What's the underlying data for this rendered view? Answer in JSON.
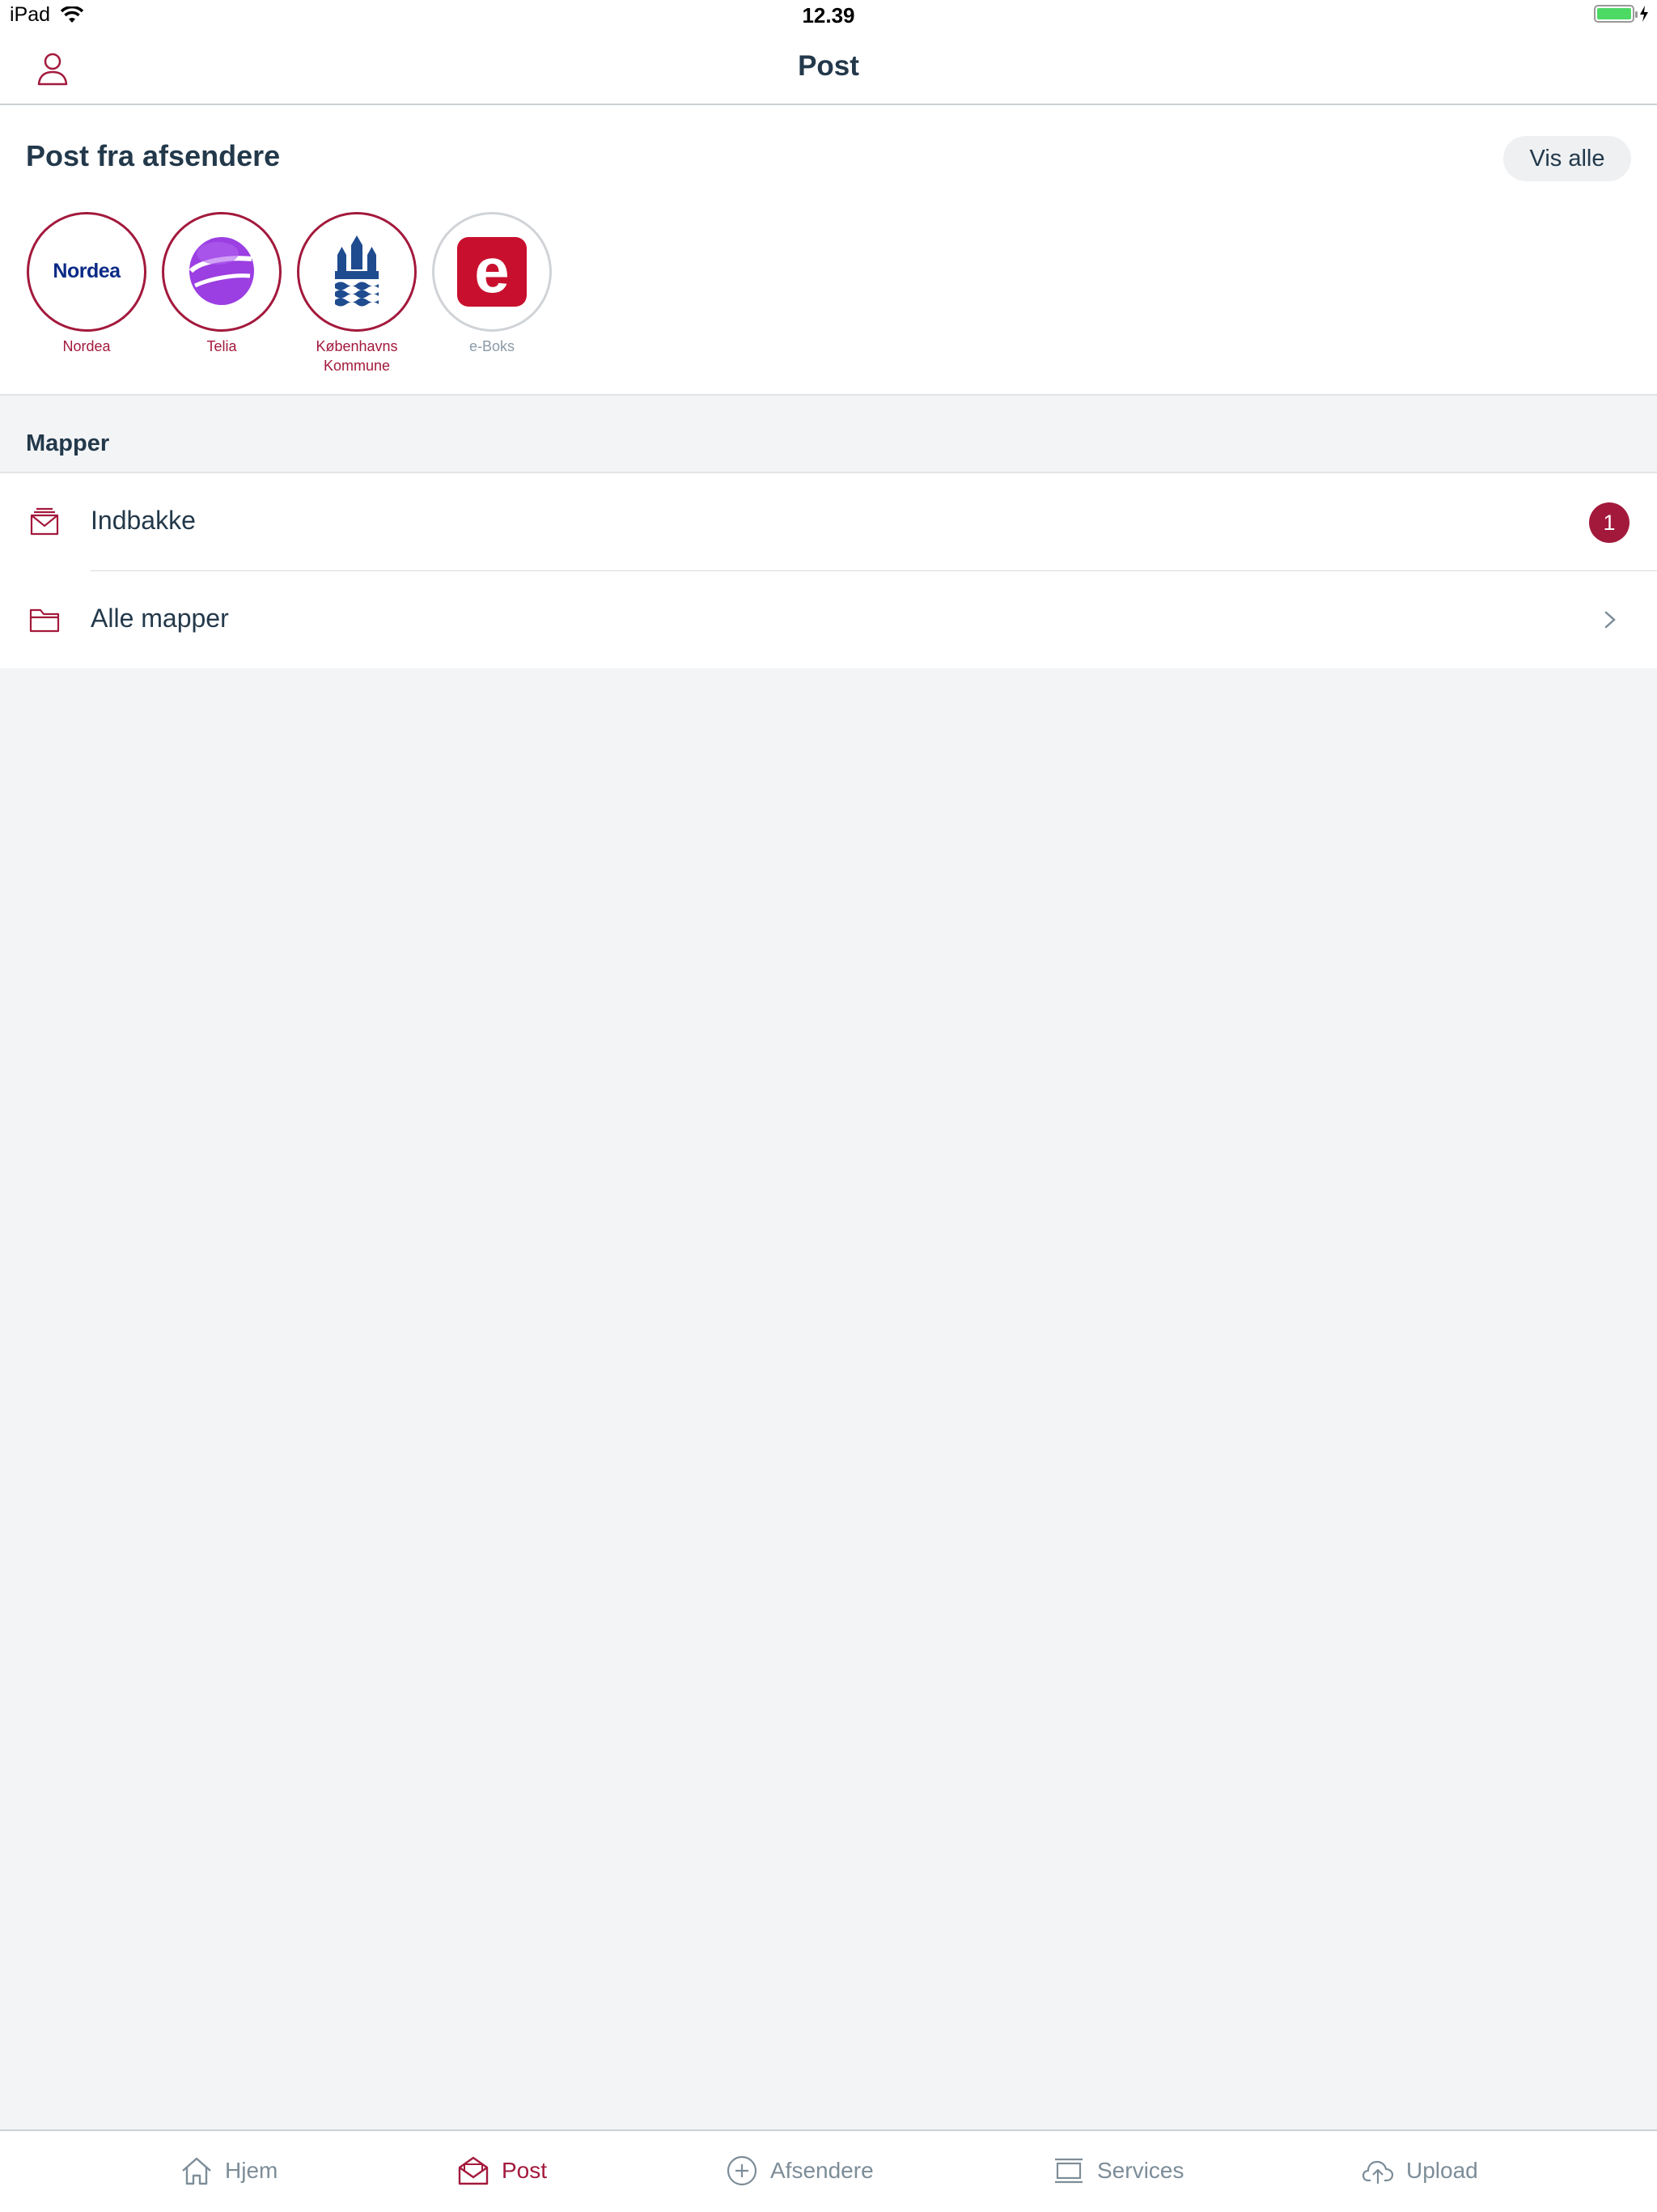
{
  "status_bar": {
    "device": "iPad",
    "time": "12.39",
    "battery_level": 1.0
  },
  "nav": {
    "title": "Post",
    "profile_icon": "person-icon"
  },
  "senders_section": {
    "title": "Post fra afsendere",
    "show_all_label": "Vis alle",
    "senders": [
      {
        "name": "Nordea",
        "logo_text": "Nordea",
        "highlighted": true
      },
      {
        "name": "Telia",
        "highlighted": true
      },
      {
        "name": "Københavns Kommune",
        "highlighted": true
      },
      {
        "name": "e-Boks",
        "logo_text": "e",
        "highlighted": false
      }
    ]
  },
  "folders_section": {
    "title": "Mapper",
    "items": [
      {
        "label": "Indbakke",
        "icon": "inbox-icon",
        "badge": "1"
      },
      {
        "label": "Alle mapper",
        "icon": "folder-icon",
        "accessory": "chevron-right-icon"
      }
    ]
  },
  "tab_bar": {
    "tabs": [
      {
        "label": "Hjem",
        "icon": "home-icon",
        "active": false
      },
      {
        "label": "Post",
        "icon": "mail-open-icon",
        "active": true
      },
      {
        "label": "Afsendere",
        "icon": "plus-circle-icon",
        "active": false
      },
      {
        "label": "Services",
        "icon": "services-icon",
        "active": false
      },
      {
        "label": "Upload",
        "icon": "cloud-upload-icon",
        "active": false
      }
    ]
  },
  "colors": {
    "accent": "#a3193c",
    "text": "#23394b",
    "background": "#f3f4f6",
    "muted": "#7d8d98"
  }
}
